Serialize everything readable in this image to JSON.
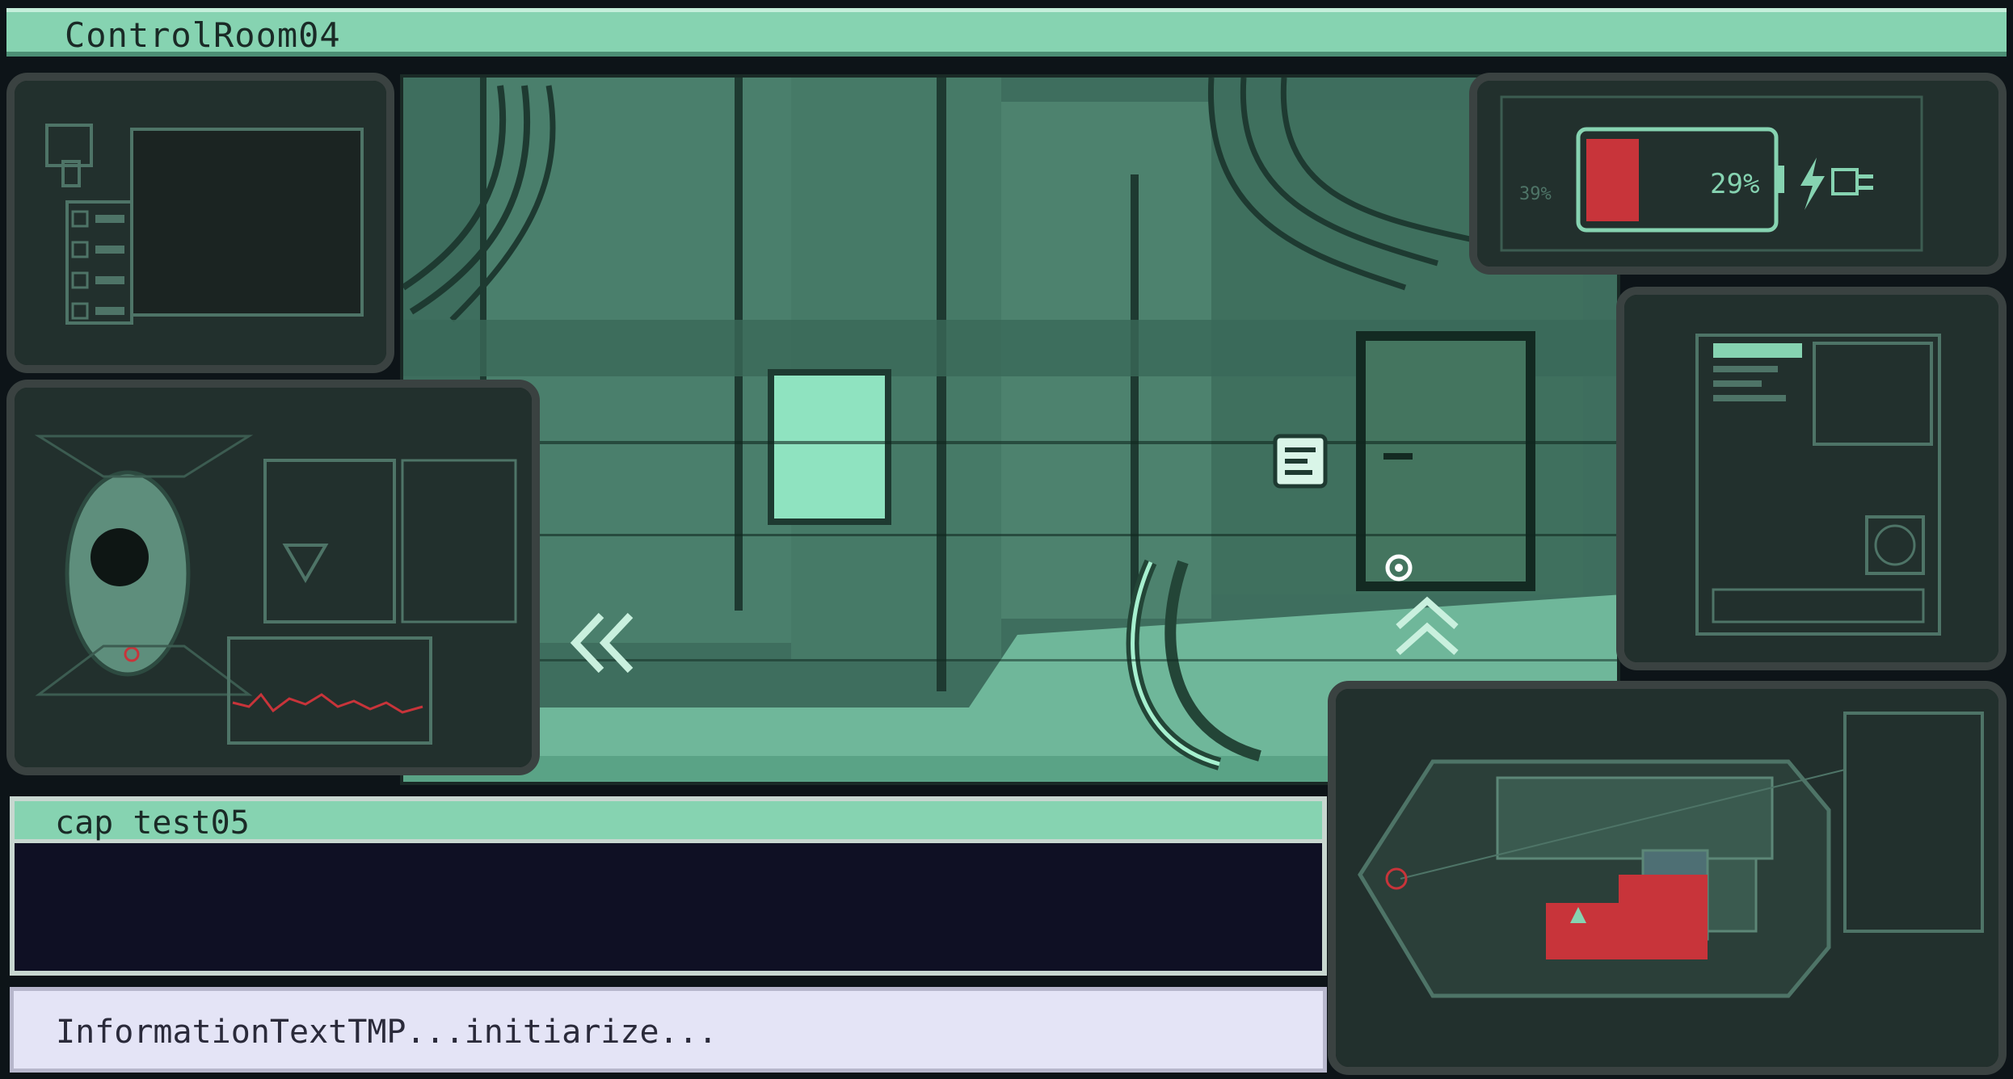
{
  "window": {
    "title": "ControlRoom04"
  },
  "caption": {
    "title": "cap test05",
    "body": ""
  },
  "info": {
    "text": "InformationTextTMP...initiarize..."
  },
  "battery": {
    "percent_label": "29%",
    "level": 0.29,
    "side_label": "39%"
  },
  "colors": {
    "accent": "#86d3b1",
    "scene_dark": "#2e5446",
    "panel_frame": "#3a4241",
    "alert_red": "#c8343a",
    "caption_bg": "#0f1024",
    "info_bg": "#e4e4f6"
  },
  "icons": {
    "nav_left": "double-chevron-left-icon",
    "nav_up": "double-chevron-up-icon",
    "cursor": "crosshair-cursor-icon",
    "wall_note": "wall-note-icon",
    "plug": "plug-icon",
    "bolt": "lightning-icon"
  }
}
